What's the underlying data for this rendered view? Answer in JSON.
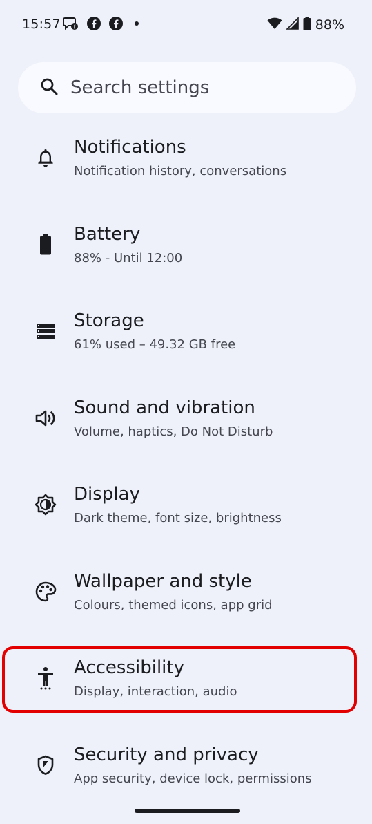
{
  "status_bar": {
    "time": "15:57",
    "battery_percent": "88%",
    "left_icons": [
      "chat-notification-icon",
      "facebook-icon",
      "facebook-icon",
      "dot-icon"
    ],
    "right_icons": [
      "wifi-icon",
      "cellular-signal-icon",
      "battery-icon"
    ]
  },
  "search": {
    "placeholder": "Search settings"
  },
  "settings": [
    {
      "title": "Notifications",
      "subtitle": "Notification history, conversations",
      "icon": "bell-icon"
    },
    {
      "title": "Battery",
      "subtitle": "88% - Until 12:00",
      "icon": "battery-icon"
    },
    {
      "title": "Storage",
      "subtitle": "61% used – 49.32 GB free",
      "icon": "storage-icon"
    },
    {
      "title": "Sound and vibration",
      "subtitle": "Volume, haptics, Do Not Disturb",
      "icon": "volume-icon"
    },
    {
      "title": "Display",
      "subtitle": "Dark theme, font size, brightness",
      "icon": "brightness-icon"
    },
    {
      "title": "Wallpaper and style",
      "subtitle": "Colours, themed icons, app grid",
      "icon": "palette-icon"
    },
    {
      "title": "Accessibility",
      "subtitle": "Display, interaction, audio",
      "icon": "accessibility-icon"
    },
    {
      "title": "Security and privacy",
      "subtitle": "App security, device lock, permissions",
      "icon": "shield-icon"
    }
  ],
  "colors": {
    "background": "#eef1f9",
    "search_background": "#f9faff",
    "text_primary": "#1b1c20",
    "text_secondary": "#45464f",
    "highlight": "#e30000"
  }
}
